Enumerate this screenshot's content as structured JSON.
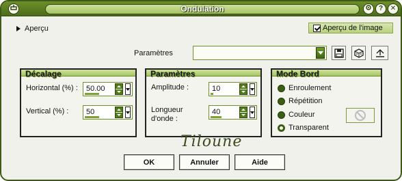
{
  "window": {
    "title": "Ondulation"
  },
  "titlebar": {
    "left_icon": "toggle-icon",
    "right_icons": [
      "refresh-icon",
      "help-icon",
      "close-icon"
    ]
  },
  "preview": {
    "toggle_label": "Aperçu",
    "checkbox_label": "Aperçu de l'image",
    "checkbox_checked": true
  },
  "presets": {
    "label": "Paramètres",
    "value": "",
    "buttons": [
      "save-preset-icon",
      "random-icon",
      "reset-icon"
    ]
  },
  "decalage": {
    "title": "Décalage",
    "horizontal": {
      "label": "Horizontal (%) :",
      "value": "50.00",
      "fill_fraction": 0.5
    },
    "vertical": {
      "label": "Vertical (%) :",
      "value": "50",
      "fill_fraction": 0.5
    }
  },
  "parametres": {
    "title": "Paramètres",
    "amplitude": {
      "label": "Amplitude :",
      "value": "10",
      "fill_fraction": 0.1
    },
    "wavelength": {
      "label_line1": "Longueur",
      "label_line2": "d'onde :",
      "value": "40",
      "fill_fraction": 0.4
    }
  },
  "mode_bord": {
    "title": "Mode Bord",
    "options": [
      "Enroulement",
      "Répétition",
      "Couleur",
      "Transparent"
    ],
    "selected": "Transparent"
  },
  "signature": "Tiloune",
  "buttons": {
    "ok": "OK",
    "cancel": "Annuler",
    "help": "Aide"
  },
  "colors": {
    "accent_green": "#4d6b1c",
    "header_light": "#b9d27c",
    "background": "#f1f1ec"
  }
}
